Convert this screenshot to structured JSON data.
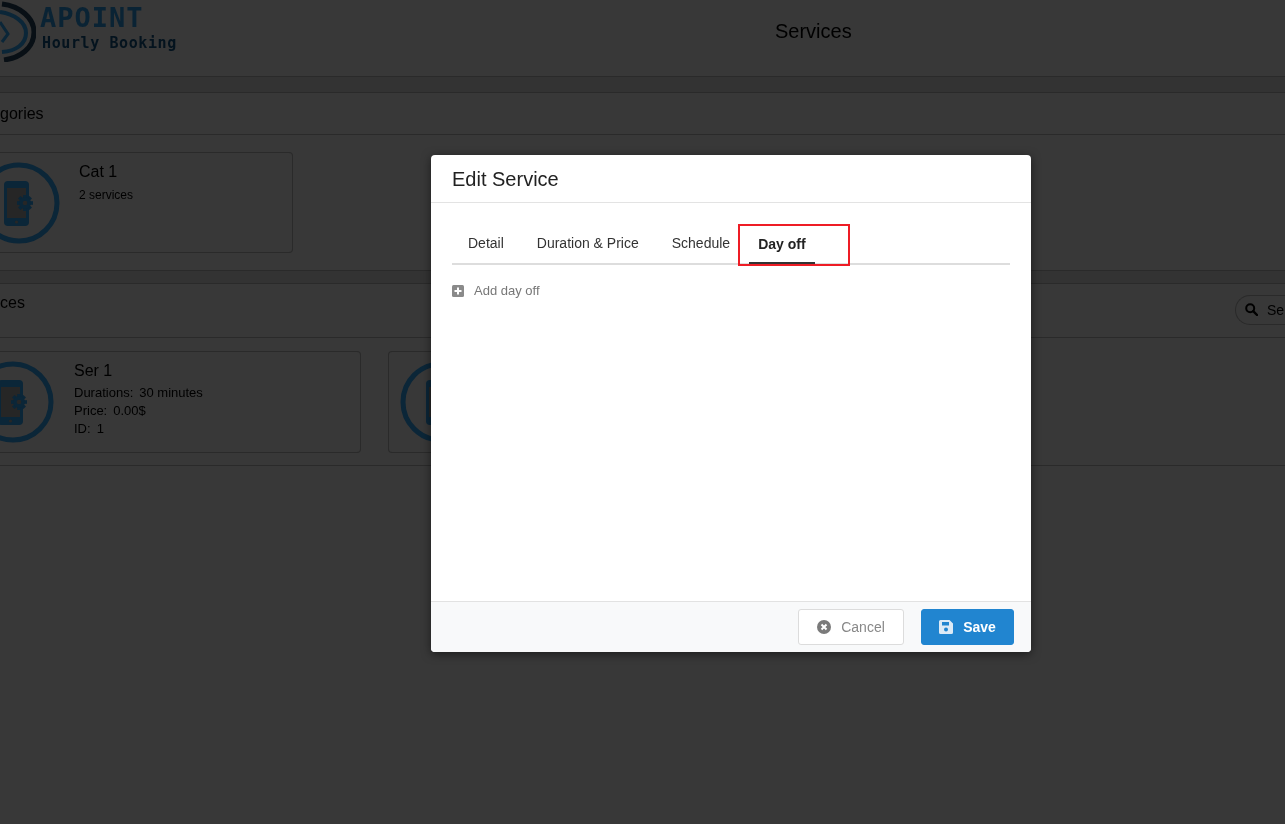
{
  "header": {
    "logo": {
      "name": "APOINT",
      "tagline": "Hourly Booking"
    },
    "title": "Services"
  },
  "categories": {
    "heading": "gories",
    "cards": [
      {
        "name": "Cat 1",
        "count": "2 services"
      }
    ]
  },
  "services": {
    "heading": "ces",
    "search": {
      "placeholder": "Se"
    },
    "cards": [
      {
        "kind": "full",
        "name": "Ser 1",
        "details": [
          {
            "label": "Durations:",
            "value": "30 minutes"
          },
          {
            "label": "Price:",
            "value": "0.00$"
          },
          {
            "label": "ID:",
            "value": "1"
          }
        ]
      },
      {
        "kind": "covered"
      }
    ]
  },
  "dialog": {
    "title": "Edit Service",
    "tabs": [
      {
        "label": "Detail",
        "selected": false,
        "highlighted": false
      },
      {
        "label": "Duration & Price",
        "selected": false,
        "highlighted": false
      },
      {
        "label": "Schedule",
        "selected": false,
        "highlighted": false
      },
      {
        "label": "Day off",
        "selected": true,
        "highlighted": true
      }
    ],
    "add_action": {
      "label": "Add day off"
    },
    "buttons": [
      {
        "kind": "cancel",
        "label": "Cancel"
      },
      {
        "kind": "save",
        "label": "Save"
      }
    ]
  }
}
